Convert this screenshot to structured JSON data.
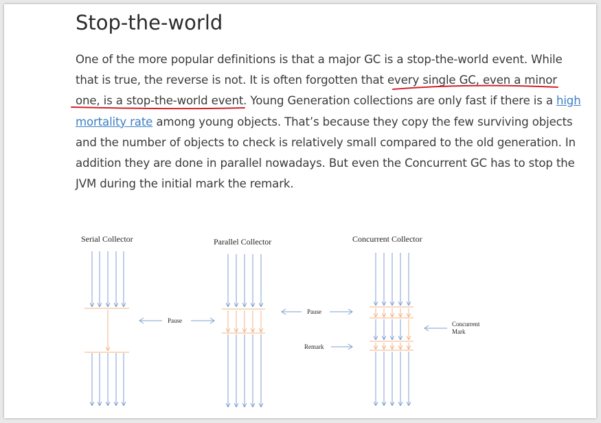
{
  "article": {
    "title": "Stop-the-world",
    "para": {
      "seg1": "One of the more popular definitions is that a major GC is a stop-the-world event. While that is true, the reverse is not. It is often forgotten that ",
      "seg2": "every single GC, even a minor one, is a stop-the-world event",
      "seg3": ". Young Generation collections are only fast if there is a ",
      "link": "high mortality rate",
      "seg4": " among young objects. That’s because they copy the few surviving objects and the number of objects to check is relatively small compared to the old generation. In addition they are done in parallel nowadays. But even the Concurrent GC has to stop the JVM during the initial mark the remark."
    }
  },
  "colors": {
    "thread_arrow": "#7f9fcf",
    "gc_marker": "#f4b183",
    "ink_underline": "#d4202a",
    "link": "#3b7fc4"
  },
  "diagram": {
    "serial_title": "Serial Collector",
    "parallel_title": "Parallel Collector",
    "concurrent_title": "Concurrent Collector",
    "pause_label_1": "Pause",
    "pause_label_2": "Pause",
    "remark_label": "Remark",
    "concurrent_mark_label_1": "Concurrent",
    "concurrent_mark_label_2": "Mark"
  }
}
